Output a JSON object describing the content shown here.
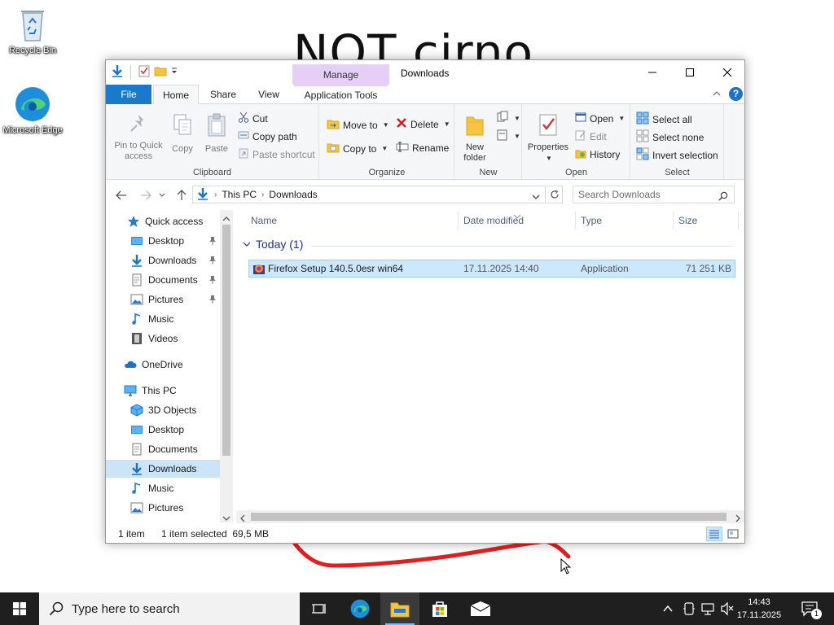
{
  "desktop": {
    "wallpaper_text": "NOT cirno",
    "icons": [
      {
        "label": "Recycle Bin",
        "icon": "recycle-bin-icon"
      },
      {
        "label": "Microsoft Edge",
        "icon": "edge-icon"
      }
    ]
  },
  "window": {
    "title": "Downloads",
    "contextual_group": "Manage",
    "controls": {
      "minimize": "minimize-icon",
      "maximize": "maximize-icon",
      "close": "close-icon"
    }
  },
  "ribbon_tabs": {
    "file": "File",
    "home": "Home",
    "share": "Share",
    "view": "View",
    "app_tools": "Application Tools"
  },
  "ribbon": {
    "clipboard": {
      "label": "Clipboard",
      "pin": "Pin to Quick access",
      "copy": "Copy",
      "paste": "Paste",
      "cut": "Cut",
      "copy_path": "Copy path",
      "paste_shortcut": "Paste shortcut"
    },
    "organize": {
      "label": "Organize",
      "move_to": "Move to",
      "copy_to": "Copy to",
      "delete": "Delete",
      "rename": "Rename"
    },
    "new": {
      "label": "New",
      "new_folder": "New folder"
    },
    "open": {
      "label": "Open",
      "properties": "Properties",
      "open": "Open",
      "edit": "Edit",
      "history": "History"
    },
    "select": {
      "label": "Select",
      "select_all": "Select all",
      "select_none": "Select none",
      "invert": "Invert selection"
    }
  },
  "address": {
    "crumbs": [
      "This PC",
      "Downloads"
    ],
    "search_placeholder": "Search Downloads"
  },
  "nav_pane": {
    "items": [
      {
        "label": "Quick access",
        "icon": "star-icon",
        "pinned": false
      },
      {
        "label": "Desktop",
        "icon": "desktop-folder-icon",
        "pinned": true
      },
      {
        "label": "Downloads",
        "icon": "download-arrow-icon",
        "pinned": true
      },
      {
        "label": "Documents",
        "icon": "documents-icon",
        "pinned": true
      },
      {
        "label": "Pictures",
        "icon": "pictures-icon",
        "pinned": true
      },
      {
        "label": "Music",
        "icon": "music-note-icon",
        "pinned": false
      },
      {
        "label": "Videos",
        "icon": "videos-icon",
        "pinned": false
      },
      {
        "label": "OneDrive",
        "icon": "cloud-icon",
        "pinned": false
      },
      {
        "label": "This PC",
        "icon": "computer-icon",
        "pinned": false
      },
      {
        "label": "3D Objects",
        "icon": "cube-icon",
        "pinned": false
      },
      {
        "label": "Desktop",
        "icon": "desktop-folder-icon",
        "pinned": false
      },
      {
        "label": "Documents",
        "icon": "documents-icon",
        "pinned": false
      },
      {
        "label": "Downloads",
        "icon": "download-arrow-icon",
        "pinned": false,
        "selected": true
      },
      {
        "label": "Music",
        "icon": "music-note-icon",
        "pinned": false
      },
      {
        "label": "Pictures",
        "icon": "pictures-icon",
        "pinned": false
      }
    ]
  },
  "file_list": {
    "columns": {
      "name": "Name",
      "date": "Date modified",
      "type": "Type",
      "size": "Size"
    },
    "group_header": "Today (1)",
    "rows": [
      {
        "name": "Firefox Setup 140.5.0esr win64",
        "date": "17.11.2025 14:40",
        "type": "Application",
        "size": "71 251 KB",
        "selected": true
      }
    ]
  },
  "status": {
    "count": "1 item",
    "selection": "1 item selected  69,5 MB"
  },
  "taskbar": {
    "search_placeholder": "Type here to search",
    "time": "14:43",
    "date": "17.11.2025",
    "notification_count": "1"
  },
  "colors": {
    "accent": "#1979ca",
    "selection": "#cce8ff",
    "manage_tab": "#e6cff7",
    "taskbar": "#1f1f1f"
  }
}
